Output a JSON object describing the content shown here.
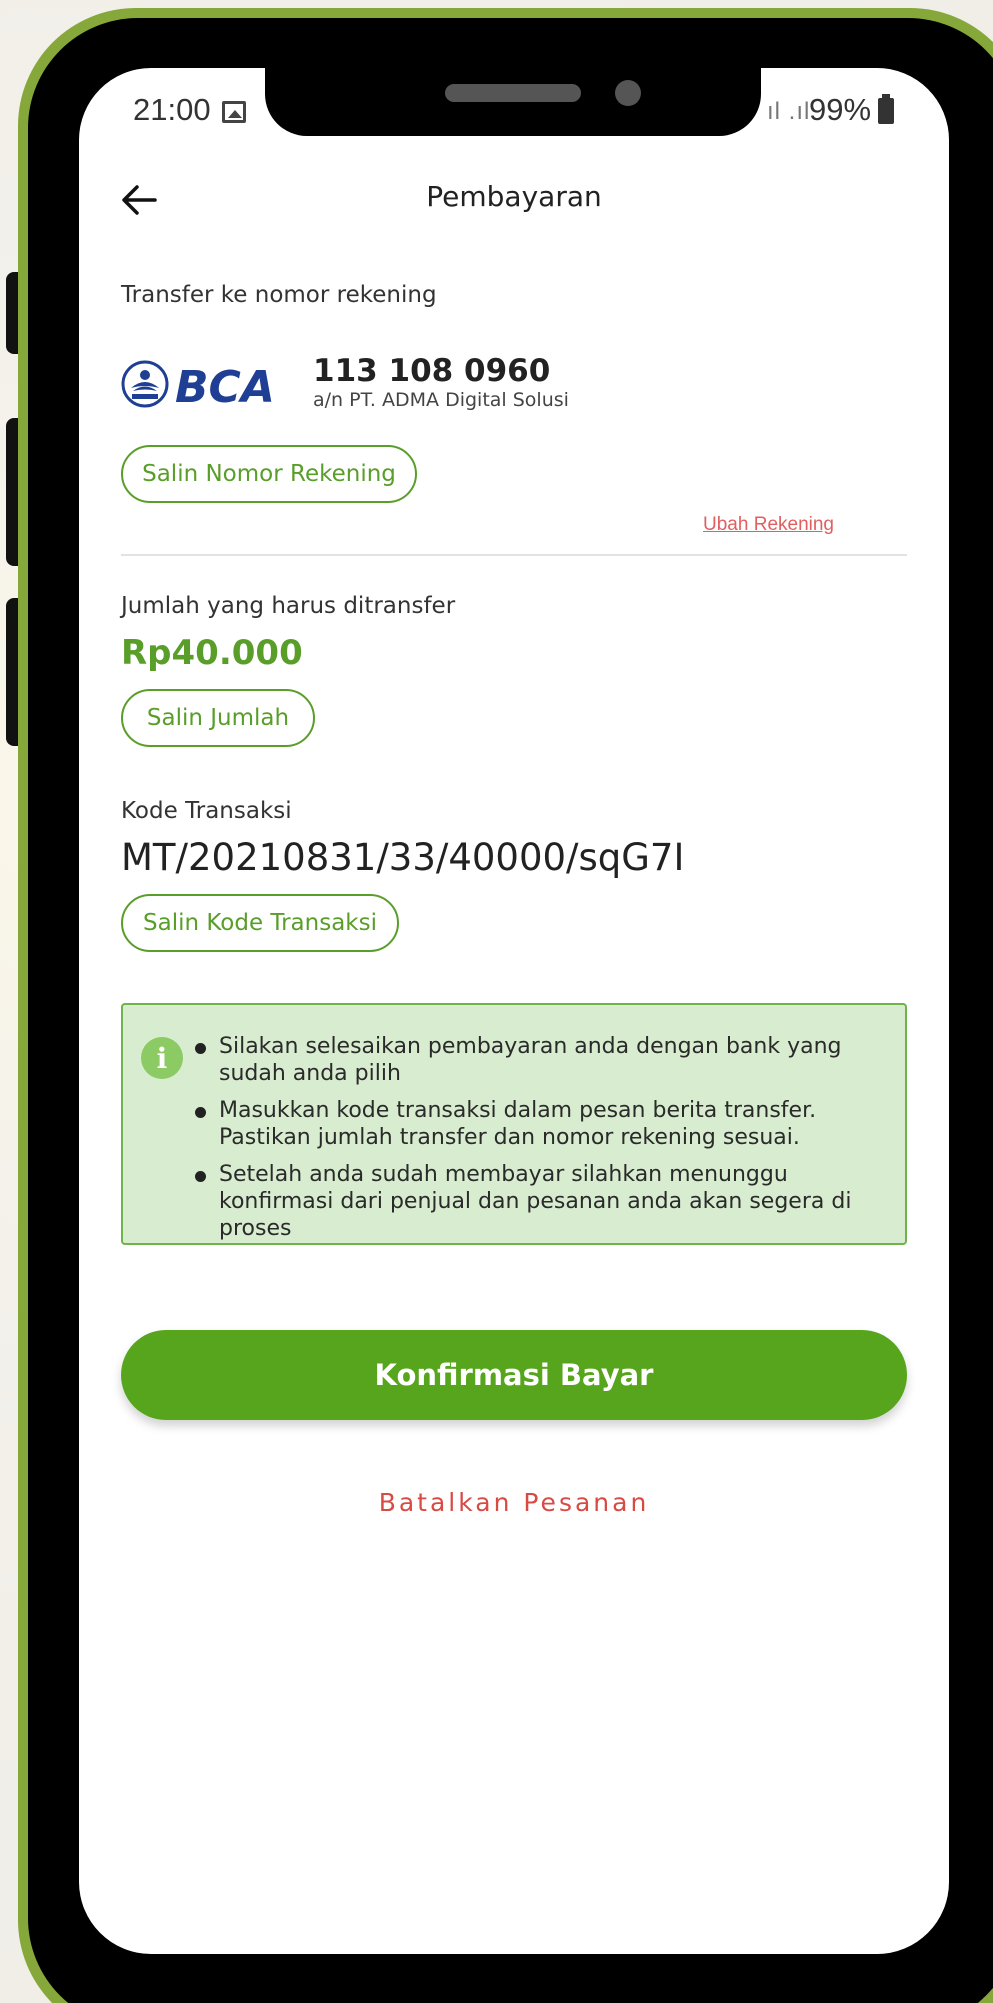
{
  "status_bar": {
    "time": "21:00",
    "signal": "ıl .ıl",
    "battery": "99%"
  },
  "header": {
    "title": "Pembayaran"
  },
  "account": {
    "label": "Transfer ke nomor rekening",
    "bank_logo_text": "BCA",
    "number": "113 108 0960",
    "holder": "a/n PT. ADMA Digital Solusi",
    "copy_button": "Salin Nomor Rekening",
    "change_link": "Ubah Rekening"
  },
  "amount": {
    "label": "Jumlah yang harus ditransfer",
    "value": "Rp40.000",
    "copy_button": "Salin Jumlah"
  },
  "transaction": {
    "label": "Kode Transaksi",
    "code": "MT/20210831/33/40000/sqG7I",
    "copy_button": "Salin Kode Transaksi"
  },
  "info": {
    "icon": "info-icon",
    "items": [
      "Silakan selesaikan pembayaran anda dengan bank yang sudah anda pilih",
      "Masukkan kode transaksi dalam pesan berita transfer. Pastikan jumlah transfer dan nomor rekening sesuai.",
      "Setelah anda sudah membayar silahkan menunggu konfirmasi dari penjual dan pesanan anda akan segera di proses"
    ]
  },
  "actions": {
    "confirm": "Konfirmasi Bayar",
    "cancel": "Batalkan Pesanan"
  },
  "colors": {
    "accent": "#56a51c",
    "frame": "#86a83a",
    "danger": "#d84a44",
    "info_bg": "#d8ecd0"
  }
}
